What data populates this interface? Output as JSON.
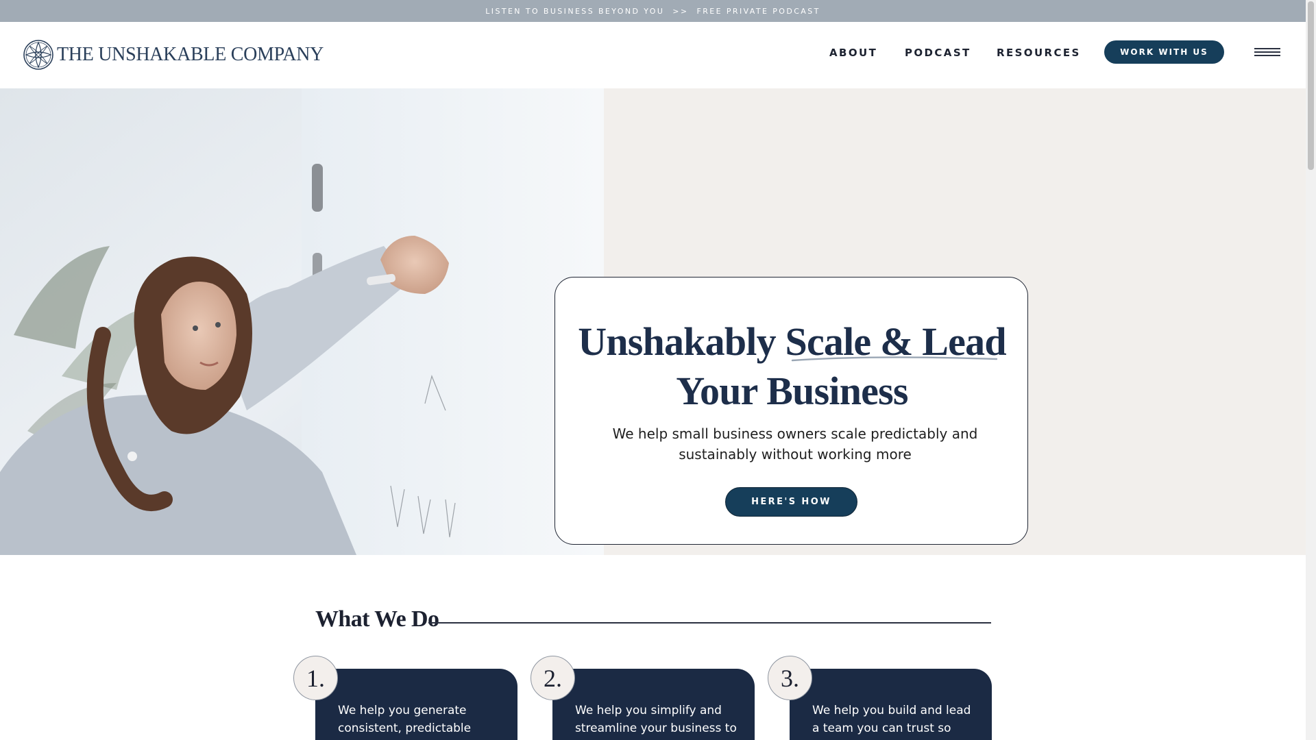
{
  "announcement": {
    "left": "LISTEN TO BUSINESS BEYOND YOU",
    "separator": ">>",
    "right": "FREE PRIVATE PODCAST"
  },
  "header": {
    "logo_text": "THE UNSHAKABLE COMPANY",
    "nav": [
      "ABOUT",
      "PODCAST",
      "RESOURCES"
    ],
    "cta": "WORK WITH US",
    "menu_icon": "hamburger-menu-icon"
  },
  "hero": {
    "title_line1_a": "Unshakably ",
    "title_line1_b": "Scale & Lead",
    "title_line2": "Your Business",
    "subtitle": "We help small business owners scale predictably and sustainably without working more",
    "button": "HERE'S HOW"
  },
  "what_we_do": {
    "title": "What We Do",
    "cards": [
      {
        "number": "1.",
        "text": "We help you generate consistent, predictable"
      },
      {
        "number": "2.",
        "text": "We help you simplify and streamline your business to"
      },
      {
        "number": "3.",
        "text": "We help you build and lead a team you can trust so"
      }
    ]
  },
  "colors": {
    "announcement_bg": "#a1abb5",
    "brand_navy": "#163e5a",
    "hero_bg": "#f2efec",
    "card_bg": "#1b2a44"
  }
}
